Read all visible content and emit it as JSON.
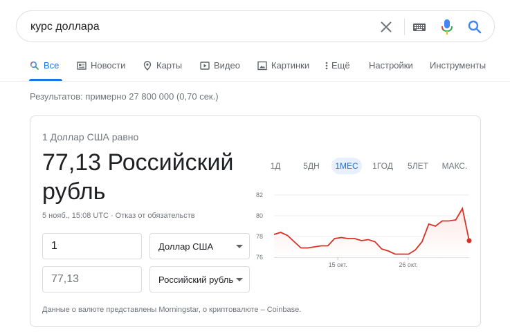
{
  "search": {
    "query": "курс доллара"
  },
  "tabs": [
    {
      "label": "Все",
      "active": true
    },
    {
      "label": "Новости"
    },
    {
      "label": "Карты"
    },
    {
      "label": "Видео"
    },
    {
      "label": "Картинки"
    },
    {
      "label": "Ещё"
    },
    {
      "label": "Настройки"
    },
    {
      "label": "Инструменты"
    }
  ],
  "results_count": "Результатов: примерно 27 800 000 (0,70 сек.)",
  "converter": {
    "equals_label": "1 Доллар США равно",
    "result_value": "77,13 Российский рубль",
    "updated": "5 нояб., 15:08 UTC",
    "separator": "·",
    "disclaimer": "Отказ от обязательств",
    "from_amount": "1",
    "from_currency": "Доллар США",
    "to_amount": "77,13",
    "to_currency": "Российский рубль",
    "source_note": "Данные о валюте представлены Morningstar, о криптовалюте – Coinbase."
  },
  "ranges": [
    "1Д",
    "5ДН",
    "1МЕС",
    "1ГОД",
    "5ЛЕТ",
    "МАКС."
  ],
  "active_range": "1МЕС",
  "colors": {
    "accent": "#1a73e8",
    "line": "#d93025",
    "area": "#fce8e6"
  },
  "chart_data": {
    "type": "area",
    "y_ticks": [
      "82",
      "80",
      "78",
      "76"
    ],
    "x_ticks": [
      "15 окт.",
      "26 окт."
    ],
    "ylim": [
      76,
      82
    ],
    "values": [
      78.2,
      78.4,
      78.1,
      77.5,
      76.9,
      76.9,
      77.0,
      77.1,
      77.1,
      77.8,
      77.9,
      77.8,
      77.8,
      77.6,
      77.7,
      77.5,
      76.8,
      76.6,
      76.3,
      76.3,
      76.3,
      76.7,
      77.5,
      79.2,
      79.0,
      79.5,
      79.5,
      79.6,
      80.7,
      77.6
    ],
    "series": [
      {
        "values": []
      }
    ]
  }
}
